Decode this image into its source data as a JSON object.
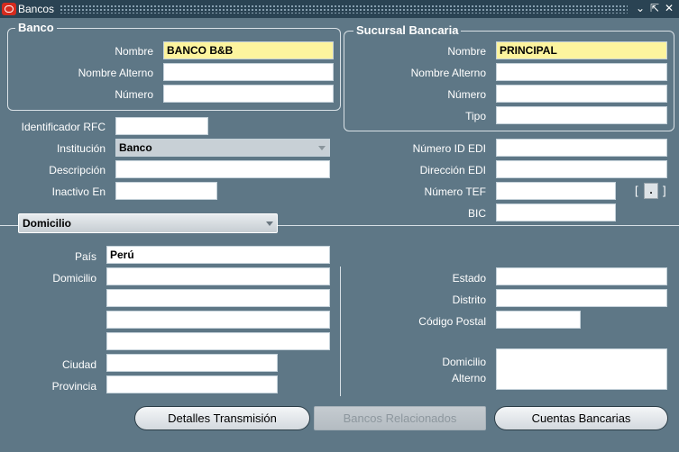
{
  "window": {
    "title": "Bancos",
    "controls": {
      "minimize": "⌄",
      "maximize": "⇱",
      "close": "✕"
    }
  },
  "banco": {
    "title": "Banco",
    "nombre_label": "Nombre",
    "nombre_value": "BANCO B&B",
    "nombre_alterno_label": "Nombre Alterno",
    "nombre_alterno_value": "",
    "numero_label": "Número",
    "numero_value": ""
  },
  "sucursal": {
    "title": "Sucursal Bancaria",
    "nombre_label": "Nombre",
    "nombre_value": "PRINCIPAL",
    "nombre_alterno_label": "Nombre Alterno",
    "numero_label": "Número",
    "tipo_label": "Tipo"
  },
  "general": {
    "rfc_label": "Identificador RFC",
    "institucion_label": "Institución",
    "institucion_value": "Banco",
    "descripcion_label": "Descripción",
    "inactivo_label": "Inactivo En",
    "numero_edi_label": "Número ID EDI",
    "direccion_edi_label": "Dirección EDI",
    "numero_tef_label": "Número TEF",
    "bic_label": "BIC",
    "tef_button": "."
  },
  "domicilio_section": {
    "selector_value": "Domicilio",
    "pais_label": "País",
    "pais_value": "Perú",
    "domicilio_label": "Domicilio",
    "ciudad_label": "Ciudad",
    "provincia_label": "Provincia",
    "estado_label": "Estado",
    "distrito_label": "Distrito",
    "codigo_postal_label": "Código Postal",
    "domicilio_alterno_label_1": "Domicilio",
    "domicilio_alterno_label_2": "Alterno"
  },
  "buttons": {
    "detalles": "Detalles Transmisión",
    "bancos_relacionados": "Bancos Relacionados",
    "cuentas": "Cuentas Bancarias"
  },
  "colors": {
    "background": "#5e7786",
    "required_field": "#fcf49e",
    "titlebar": "#2a4353"
  }
}
